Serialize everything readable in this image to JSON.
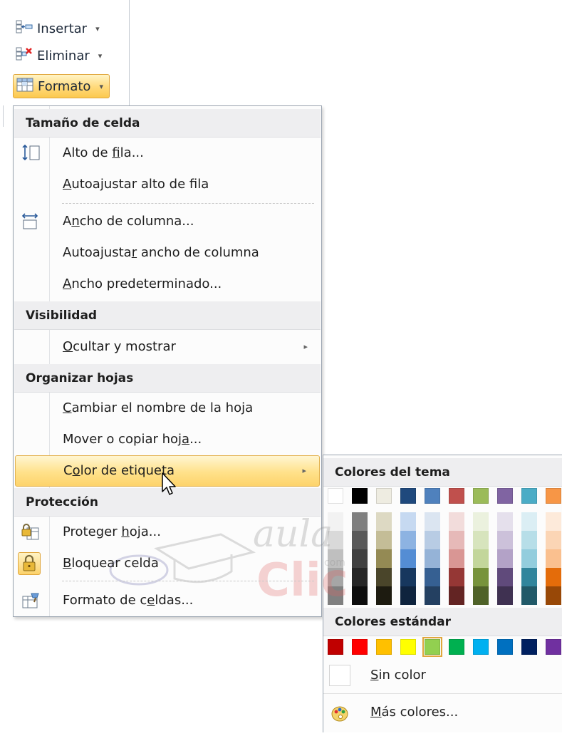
{
  "ribbon": {
    "buttons": [
      {
        "label": "Insertar",
        "icon": "insert-cells-icon"
      },
      {
        "label": "Eliminar",
        "icon": "delete-cells-icon"
      },
      {
        "label": "Formato",
        "icon": "format-cells-icon",
        "active": true
      }
    ],
    "dropdown_glyph": "▾"
  },
  "menu": {
    "sections": {
      "cell_size": "Tamaño de celda",
      "visibility": "Visibilidad",
      "organize": "Organizar hojas",
      "protection": "Protección"
    },
    "items": {
      "row_height": {
        "before": "Alto de ",
        "key": "f",
        "after": "ila..."
      },
      "autofit_row": {
        "before": "",
        "key": "A",
        "after": "utoajustar alto de fila"
      },
      "col_width": {
        "before": "A",
        "key": "n",
        "after": "cho de columna..."
      },
      "autofit_col": {
        "before": "Autoajusta",
        "key": "r",
        "after": " ancho de columna"
      },
      "default_width": {
        "before": "",
        "key": "A",
        "after": "ncho predeterminado..."
      },
      "hide_show": {
        "before": "",
        "key": "O",
        "after": "cultar y mostrar"
      },
      "rename_sheet": {
        "before": "",
        "key": "C",
        "after": "ambiar el nombre de la hoja"
      },
      "move_copy": {
        "before": "Mover o copiar hoj",
        "key": "a",
        "after": "..."
      },
      "tab_color": {
        "before": "C",
        "key": "o",
        "after": "lor de etiqueta"
      },
      "protect_sheet": {
        "before": "Proteger ",
        "key": "h",
        "after": "oja..."
      },
      "lock_cell": {
        "before": "",
        "key": "B",
        "after": "loquear celda"
      },
      "format_cells": {
        "before": "Formato de c",
        "key": "e",
        "after": "ldas..."
      }
    },
    "submenu_glyph": "▸"
  },
  "submenu": {
    "theme_title": "Colores del tema",
    "standard_title": "Colores estándar",
    "no_color": {
      "before": "",
      "key": "S",
      "after": "in color"
    },
    "more_colors": {
      "before": "",
      "key": "M",
      "after": "ás colores..."
    },
    "theme_colors": [
      "#ffffff",
      "#000000",
      "#eeece1",
      "#1f497d",
      "#4f81bd",
      "#c0504d",
      "#9bbb59",
      "#8064a2",
      "#4bacc6",
      "#f79646"
    ],
    "theme_shades": [
      [
        "#f2f2f2",
        "#d9d9d9",
        "#bfbfbf",
        "#a6a6a6",
        "#808080"
      ],
      [
        "#7f7f7f",
        "#595959",
        "#404040",
        "#262626",
        "#0d0d0d"
      ],
      [
        "#ddd9c3",
        "#c4bd97",
        "#948a54",
        "#4a452a",
        "#1d1b10"
      ],
      [
        "#c6d9f1",
        "#8db3e2",
        "#548dd4",
        "#17375e",
        "#0f243e"
      ],
      [
        "#dbe5f1",
        "#b8cce4",
        "#95b3d7",
        "#366092",
        "#244061"
      ],
      [
        "#f2dcdb",
        "#e6b9b8",
        "#d99694",
        "#953735",
        "#632423"
      ],
      [
        "#ebf1de",
        "#d7e4bd",
        "#c3d69b",
        "#77933c",
        "#4f6228"
      ],
      [
        "#e5e0ec",
        "#ccc1da",
        "#b3a2c7",
        "#604a7b",
        "#3f3151"
      ],
      [
        "#dbeef4",
        "#b7dee8",
        "#93cddd",
        "#31859c",
        "#215968"
      ],
      [
        "#fdeada",
        "#fbd5b5",
        "#fac08f",
        "#e46c0a",
        "#984807"
      ]
    ],
    "standard_colors": [
      "#c00000",
      "#ff0000",
      "#ffc000",
      "#ffff00",
      "#92d050",
      "#00b050",
      "#00b0f0",
      "#0070c0",
      "#002060",
      "#7030a0"
    ],
    "selected_standard_index": 4
  },
  "watermark": {
    "line1": "aula",
    "line2": "Clic",
    "small": "com"
  }
}
